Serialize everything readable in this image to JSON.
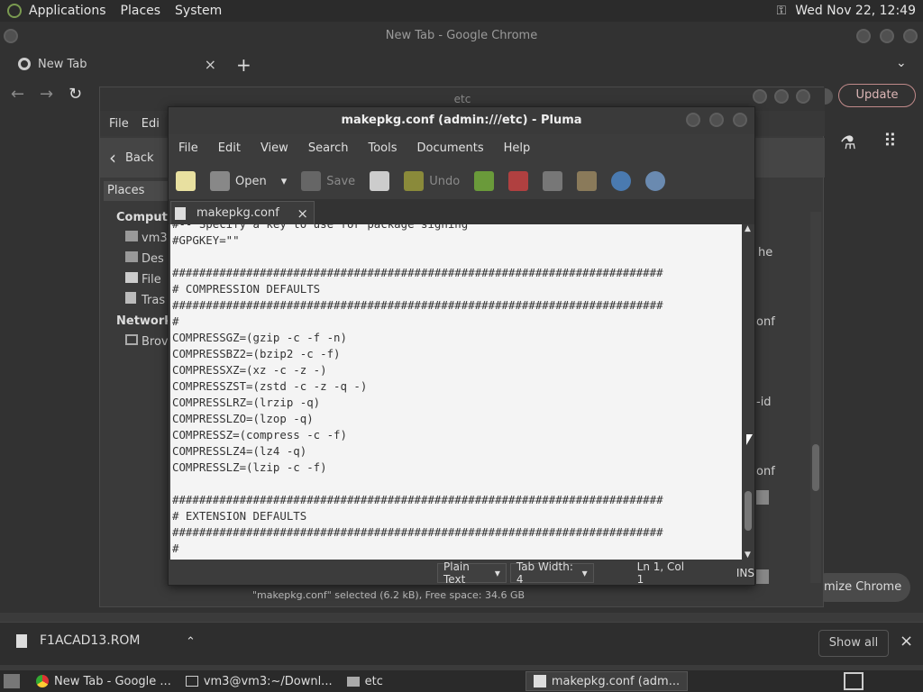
{
  "top_panel": {
    "menus": [
      "Applications",
      "Places",
      "System"
    ],
    "datetime": "Wed Nov 22, 12:49"
  },
  "chrome": {
    "window_title": "New Tab - Google Chrome",
    "tab_label": "New Tab",
    "update_label": "Update",
    "customize_label": "mize Chrome"
  },
  "file_manager": {
    "window_title": "etc",
    "menus": [
      "File",
      "Edi"
    ],
    "back_label": "Back",
    "places_label": "Places",
    "sidebar": [
      {
        "label": "Compute",
        "heading": true
      },
      {
        "label": "vm3"
      },
      {
        "label": "Des"
      },
      {
        "label": "File"
      },
      {
        "label": "Tras"
      },
      {
        "label": "Network",
        "heading": true
      },
      {
        "label": "Brov"
      }
    ],
    "right_fragments": [
      "he",
      "onf",
      "-id",
      "onf"
    ],
    "status": "\"makepkg.conf\" selected (6.2 kB), Free space: 34.6 GB"
  },
  "pluma": {
    "window_title": "makepkg.conf (admin:///etc) - Pluma",
    "menus": [
      "File",
      "Edit",
      "View",
      "Search",
      "Tools",
      "Documents",
      "Help"
    ],
    "toolbar": {
      "open": "Open",
      "save": "Save",
      "undo": "Undo"
    },
    "tab_label": "makepkg.conf",
    "code": "#-- Specify a key to use for package signing\n#GPGKEY=\"\"\n\n#########################################################################\n# COMPRESSION DEFAULTS\n#########################################################################\n#\nCOMPRESSGZ=(gzip -c -f -n)\nCOMPRESSBZ2=(bzip2 -c -f)\nCOMPRESSXZ=(xz -c -z -)\nCOMPRESSZST=(zstd -c -z -q -)\nCOMPRESSLRZ=(lrzip -q)\nCOMPRESSLZO=(lzop -q)\nCOMPRESSZ=(compress -c -f)\nCOMPRESSLZ4=(lz4 -q)\nCOMPRESSLZ=(lzip -c -f)\n\n#########################################################################\n# EXTENSION DEFAULTS\n#########################################################################\n#",
    "status": {
      "language": "Plain Text",
      "tab_width": "Tab Width:  4",
      "position": "Ln 1, Col 1",
      "mode": "INS"
    }
  },
  "downloads": {
    "file": "F1ACAD13.ROM",
    "show_all": "Show all"
  },
  "taskbar": {
    "items": [
      "New Tab - Google ...",
      "vm3@vm3:~/Downl...",
      "etc",
      "makepkg.conf (adm..."
    ]
  }
}
